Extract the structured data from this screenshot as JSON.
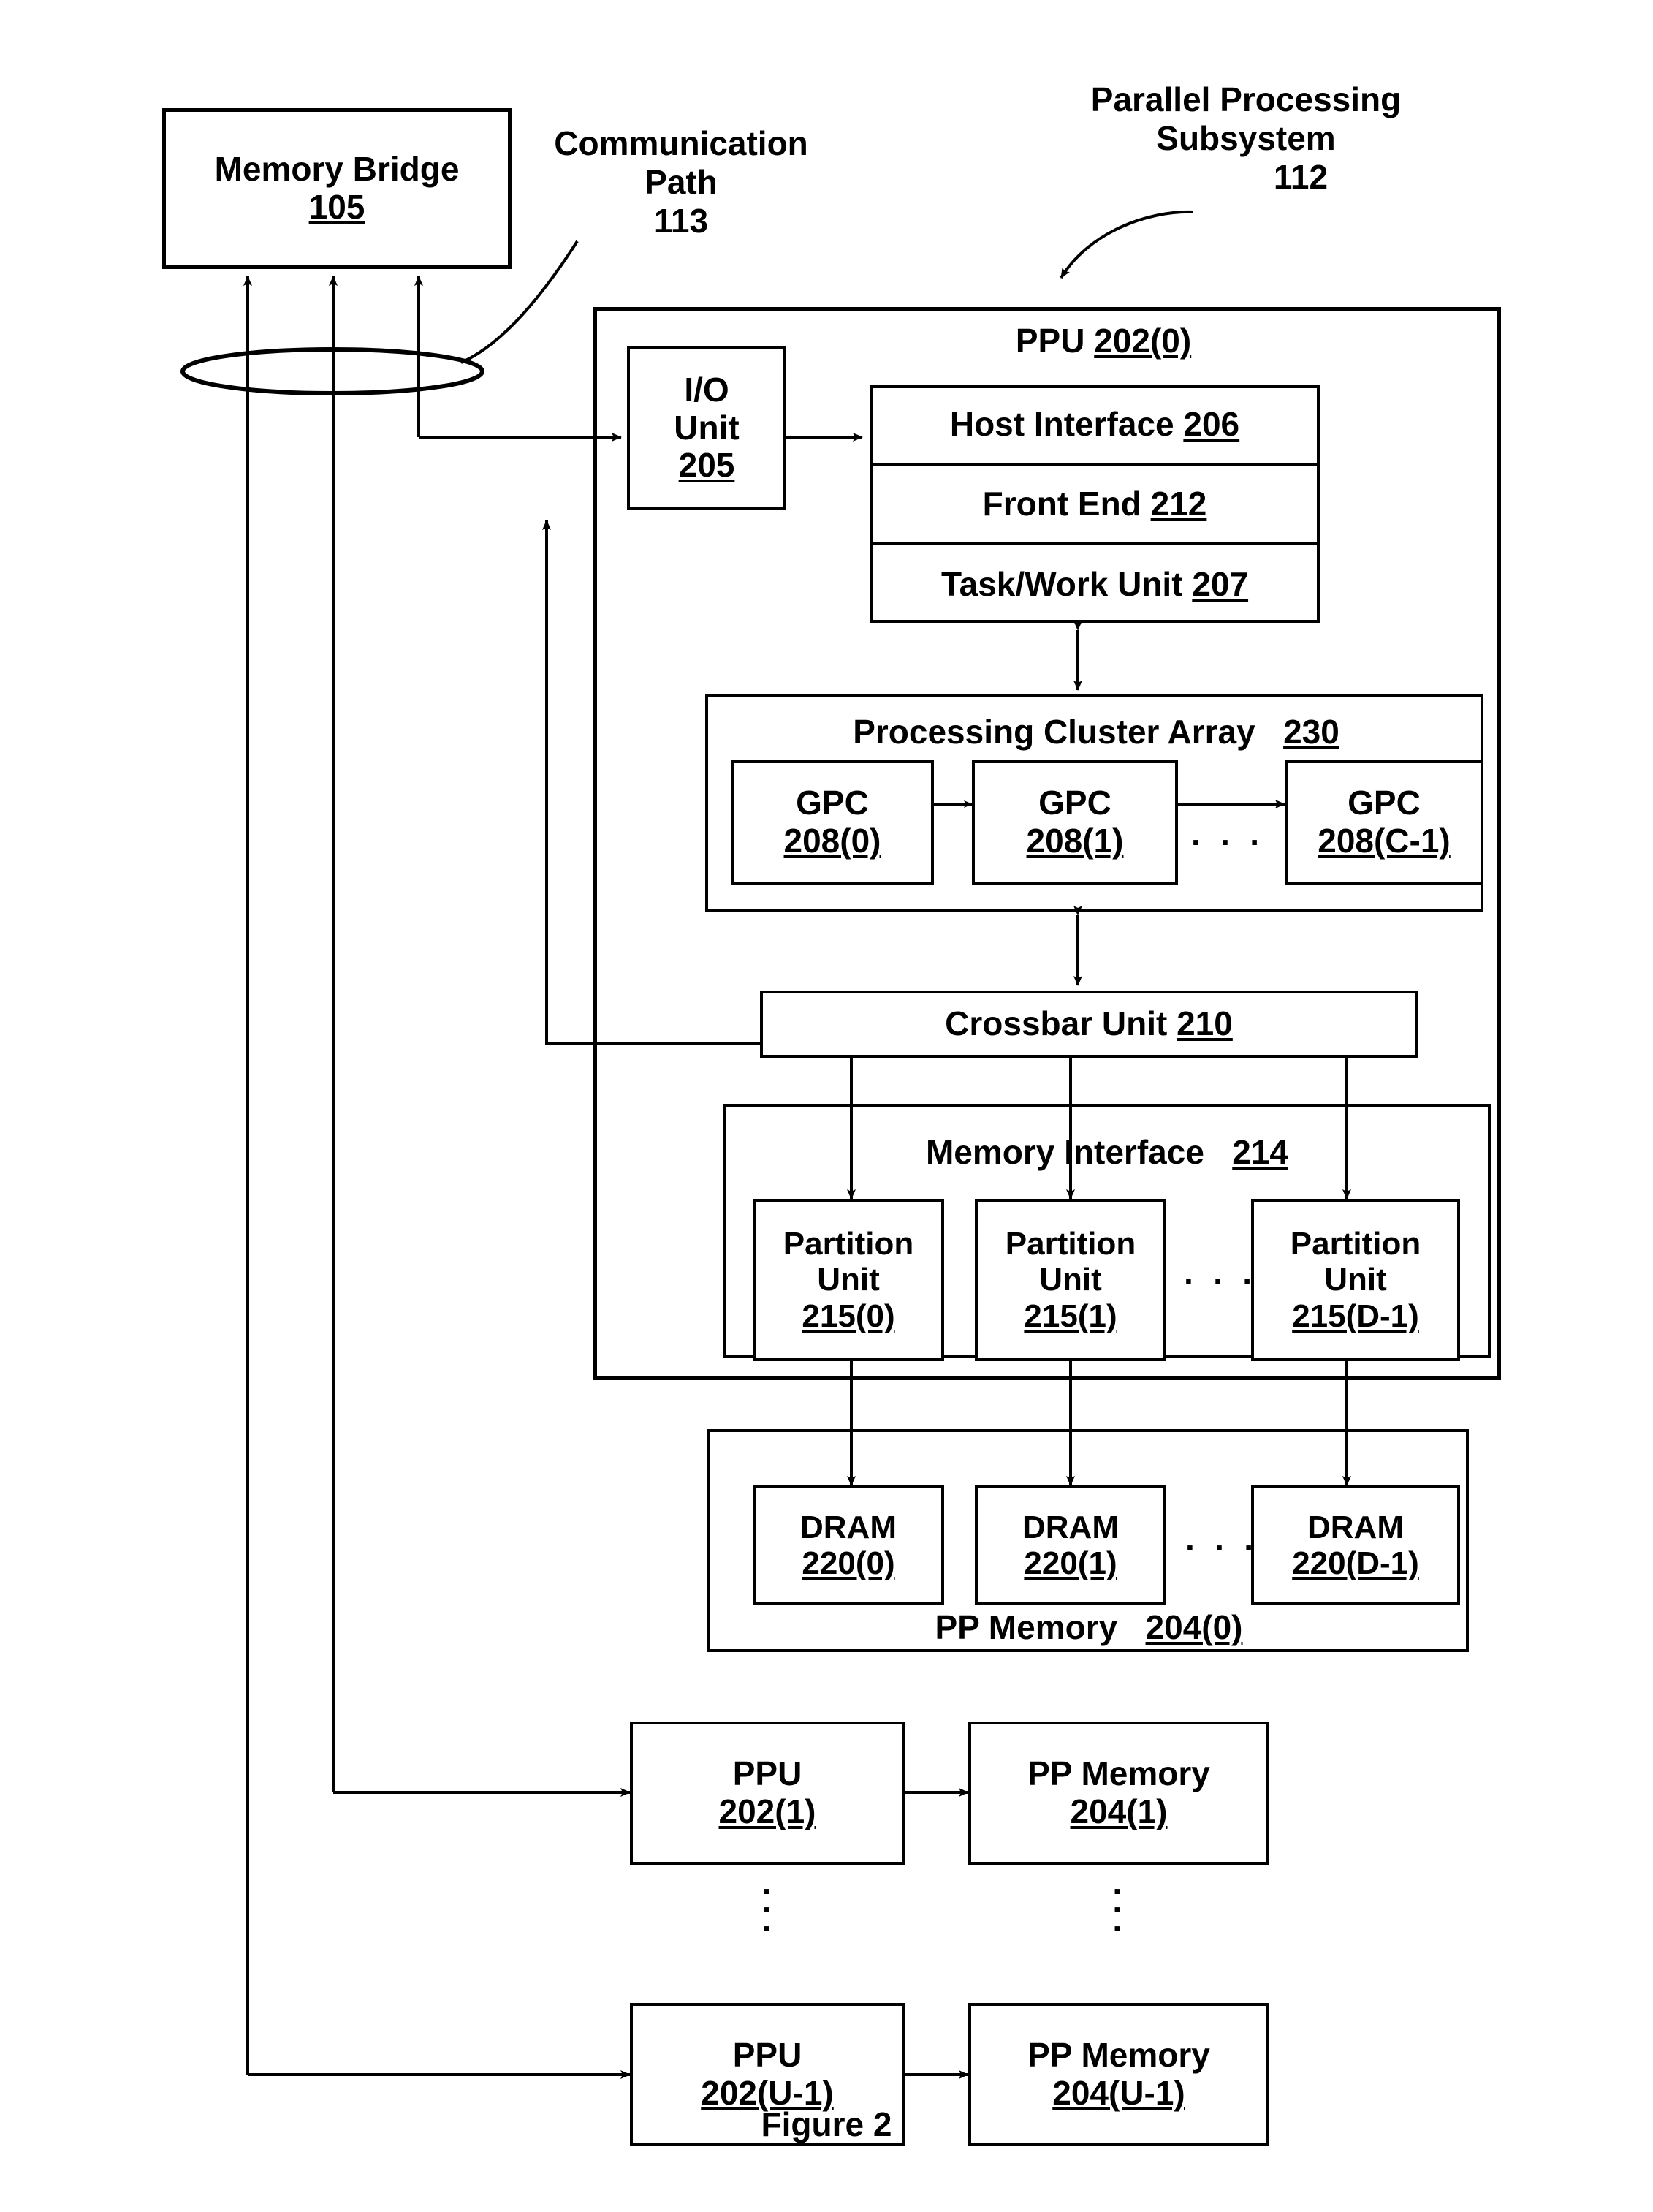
{
  "figure": {
    "caption": "Figure 2"
  },
  "annotations": {
    "communication_path": {
      "line1": "Communication",
      "line2": "Path",
      "ref": "113"
    },
    "parallel_processing_subsystem": {
      "line1": "Parallel Processing",
      "line2": "Subsystem",
      "ref": "112"
    }
  },
  "memory_bridge": {
    "title": "Memory Bridge",
    "ref": "105"
  },
  "ppu0": {
    "title": "PPU",
    "ref": "202(0)",
    "io_unit": {
      "line1": "I/O",
      "line2": "Unit",
      "ref": "205"
    },
    "front_stack": [
      {
        "title": "Host Interface",
        "ref": "206"
      },
      {
        "title": "Front End",
        "ref": "212"
      },
      {
        "title": "Task/Work Unit",
        "ref": "207"
      }
    ],
    "processing_cluster_array": {
      "title": "Processing Cluster Array",
      "ref": "230",
      "ellipsis": "· · ·",
      "gpcs": [
        {
          "title": "GPC",
          "ref": "208(0)"
        },
        {
          "title": "GPC",
          "ref": "208(1)"
        },
        {
          "title": "GPC",
          "ref": "208(C-1)"
        }
      ]
    },
    "crossbar_unit": {
      "title": "Crossbar Unit",
      "ref": "210"
    },
    "memory_interface": {
      "title": "Memory Interface",
      "ref": "214",
      "ellipsis": "· · ·",
      "partitions": [
        {
          "line1": "Partition",
          "line2": "Unit",
          "ref": "215(0)"
        },
        {
          "line1": "Partition",
          "line2": "Unit",
          "ref": "215(1)"
        },
        {
          "line1": "Partition",
          "line2": "Unit",
          "ref": "215(D-1)"
        }
      ]
    }
  },
  "pp_memory0": {
    "title": "PP Memory",
    "ref": "204(0)",
    "ellipsis": "· · ·",
    "drams": [
      {
        "title": "DRAM",
        "ref": "220(0)"
      },
      {
        "title": "DRAM",
        "ref": "220(1)"
      },
      {
        "title": "DRAM",
        "ref": "220(D-1)"
      }
    ]
  },
  "additional_units": {
    "vertical_ellipsis": "·\n·\n·",
    "rows": [
      {
        "ppu": {
          "title": "PPU",
          "ref": "202(1)"
        },
        "mem": {
          "title": "PP Memory",
          "ref": "204(1)"
        }
      },
      {
        "ppu": {
          "title": "PPU",
          "ref": "202(U-1)"
        },
        "mem": {
          "title": "PP Memory",
          "ref": "204(U-1)"
        }
      }
    ]
  },
  "colors": {
    "ink": "#000000",
    "paper": "#ffffff"
  }
}
